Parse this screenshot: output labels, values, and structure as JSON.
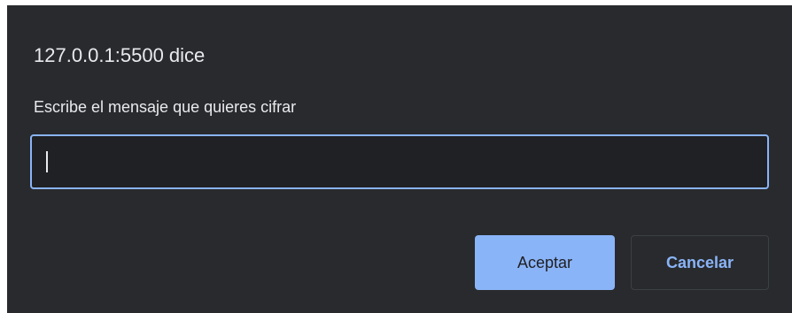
{
  "dialog": {
    "origin": "127.0.0.1:5500 dice",
    "message": "Escribe el mensaje que quieres cifrar",
    "input": {
      "value": "",
      "placeholder": ""
    },
    "buttons": {
      "ok_label": "Aceptar",
      "cancel_label": "Cancelar"
    }
  },
  "colors": {
    "dialog_bg": "#292a2d",
    "input_bg": "#202124",
    "accent": "#8ab4f8",
    "text": "#e8eaed",
    "button_border": "#3c4043"
  }
}
